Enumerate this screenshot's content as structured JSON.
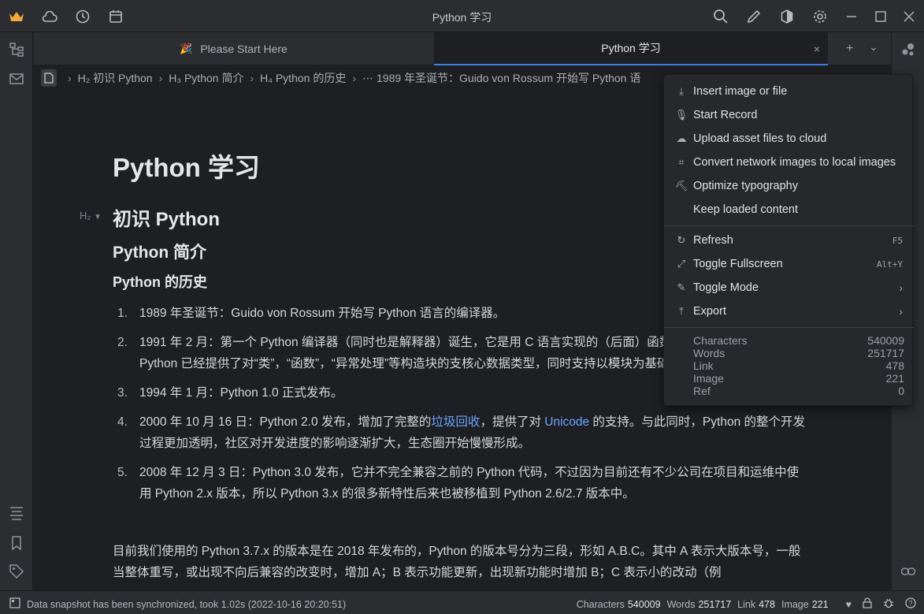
{
  "window": {
    "title": "Python 学习"
  },
  "tabs": [
    {
      "label": "Please Start Here",
      "emoji": "🎉"
    },
    {
      "label": "Python 学习",
      "close": "×"
    }
  ],
  "tabbar_actions": {
    "add": "+",
    "more": "⌄"
  },
  "breadcrumb": {
    "items": [
      "H₂ 初识 Python",
      "H₃ Python 简介",
      "H₄ Python 的历史",
      "1989 年圣诞节：Guido von Rossum 开始写 Python 语"
    ]
  },
  "document": {
    "title": "Python 学习",
    "h2_marker": "H₂",
    "h2": "初识 Python",
    "h3": "Python 简介",
    "h4": "Python 的历史",
    "list": [
      {
        "num": "1.",
        "text": "1989 年圣诞节：Guido von Rossum 开始写 Python 语言的编译器。"
      },
      {
        "num": "2.",
        "text": "1991 年 2 月：第一个 Python 编译器（同时也是解释器）诞生，它是用 C 语言实现的（后面）函数。在最早的版本中，Python 已经提供了对“类”，“函数”，“异常处理”等构造块的支核心数据类型，同时支持以模块为基础来构造应用程序。"
      },
      {
        "num": "3.",
        "text": "1994 年 1 月：Python 1.0 正式发布。"
      },
      {
        "num": "4.",
        "text_before": "2000 年 10 月 16 日：Python 2.0 发布，增加了完整的",
        "link1": "垃圾回收",
        "text_mid": "，提供了对 ",
        "link2": "Unicode",
        "text_after": " 的支持。与此同时，Python 的整个开发过程更加透明，社区对开发进度的影响逐渐扩大，生态圈开始慢慢形成。"
      },
      {
        "num": "5.",
        "text": "2008 年 12 月 3 日：Python 3.0 发布，它并不完全兼容之前的 Python 代码，不过因为目前还有不少公司在项目和运维中使用 Python 2.x 版本，所以 Python 3.x 的很多新特性后来也被移植到 Python 2.6/2.7 版本中。"
      }
    ],
    "paragraph": "目前我们使用的 Python 3.7.x 的版本是在 2018 年发布的，Python 的版本号分为三段，形如 A.B.C。其中 A 表示大版本号，一般当整体重写，或出现不向后兼容的改变时，增加 A；B 表示功能更新，出现新功能时增加 B；C 表示小的改动（例"
  },
  "menu": {
    "items": [
      {
        "label": "Insert image or file",
        "icon": "download-icon"
      },
      {
        "label": "Start Record",
        "icon": "microphone-icon"
      },
      {
        "label": "Upload asset files to cloud",
        "icon": "cloud-icon"
      },
      {
        "label": "Convert network images to local images",
        "icon": "crop-icon"
      },
      {
        "label": "Optimize typography",
        "icon": "paint-roller-icon"
      },
      {
        "label": "Keep loaded content",
        "icon": ""
      },
      {
        "label": "Refresh",
        "icon": "refresh-icon",
        "shortcut": "F5"
      },
      {
        "label": "Toggle Fullscreen",
        "icon": "expand-icon",
        "shortcut": "Alt+Y"
      },
      {
        "label": "Toggle Mode",
        "icon": "pencil-icon",
        "submenu": "›"
      },
      {
        "label": "Export",
        "icon": "upload-icon",
        "submenu": "›"
      }
    ],
    "stats": [
      {
        "label": "Characters",
        "value": "540009"
      },
      {
        "label": "Words",
        "value": "251717"
      },
      {
        "label": "Link",
        "value": "478"
      },
      {
        "label": "Image",
        "value": "221"
      },
      {
        "label": "Ref",
        "value": "0"
      }
    ]
  },
  "statusbar": {
    "message": "Data snapshot has been synchronized, took 1.02s (2022-10-16 20:20:51)",
    "characters_label": "Characters",
    "characters": "540009",
    "words_label": "Words",
    "words": "251717",
    "link_label": "Link",
    "link": "478",
    "image_label": "Image",
    "image": "221"
  },
  "colors": {
    "accent": "#3d7fe0",
    "link": "#6aa5ff",
    "crown": "#f2a73b"
  }
}
